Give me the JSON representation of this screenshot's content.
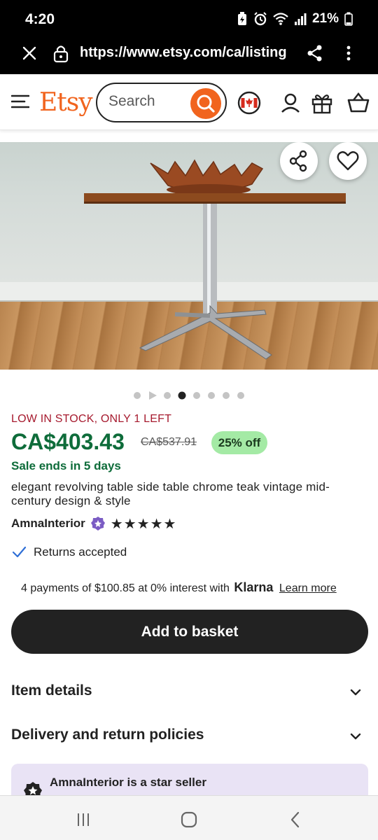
{
  "status": {
    "time": "4:20",
    "battery": "21%"
  },
  "browser": {
    "url": "https://www.etsy.com/ca/listing"
  },
  "header": {
    "logo": "Etsy",
    "search_placeholder": "Search"
  },
  "gallery": {
    "dot_count": 8,
    "active_index": 3
  },
  "listing": {
    "stock_notice": "LOW IN STOCK, ONLY 1 LEFT",
    "price": "CA$403.43",
    "original_price": "CA$537.91",
    "discount": "25% off",
    "sale_ends": "Sale ends in 5 days",
    "title": "elegant revolving table side table chrome teak vintage mid-century design & style",
    "shop_name": "AmnaInterior",
    "rating_stars": "★★★★★",
    "returns": "Returns accepted",
    "klarna_text": "4 payments of $100.85 at 0% interest with",
    "klarna_brand": "Klarna",
    "klarna_link": "Learn more",
    "add_to_basket": "Add to basket"
  },
  "sections": [
    {
      "label": "Item details"
    },
    {
      "label": "Delivery and return policies"
    }
  ],
  "star_seller": {
    "text": "AmnaInterior is a star seller"
  },
  "colors": {
    "brand_orange": "#f1641e",
    "price_green": "#0e6c3a",
    "stock_red": "#a61a2e",
    "discount_bg": "#a4eaa5",
    "button_dark": "#222222"
  }
}
